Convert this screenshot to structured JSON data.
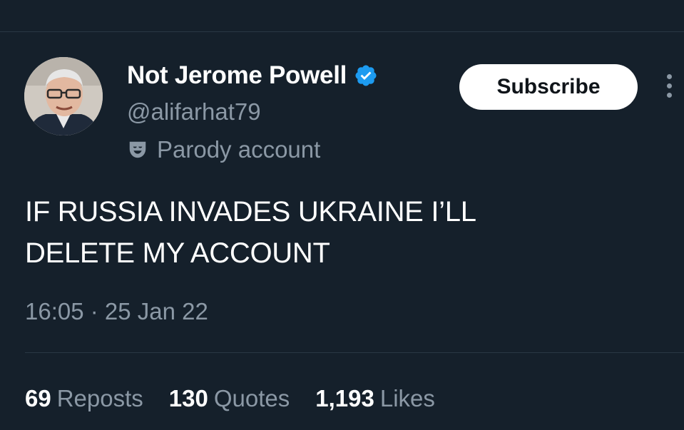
{
  "profile": {
    "display_name": "Not Jerome Powell",
    "handle": "@alifarhat79",
    "account_label": "Parody account",
    "verified": true,
    "verified_color": "#1d9bf0"
  },
  "actions": {
    "subscribe_label": "Subscribe",
    "more_icon": "more-vertical-icon"
  },
  "tweet": {
    "line1": "IF RUSSIA INVADES UKRAINE I’LL",
    "line2": "DELETE MY ACCOUNT",
    "timestamp": "16:05 · 25 Jan 22"
  },
  "stats": {
    "reposts_count": "69",
    "reposts_label": "Reposts",
    "quotes_count": "130",
    "quotes_label": "Quotes",
    "likes_count": "1,193",
    "likes_label": "Likes"
  },
  "theme": {
    "background": "#15202b",
    "text_primary": "#ffffff",
    "text_secondary": "#8b98a5"
  }
}
